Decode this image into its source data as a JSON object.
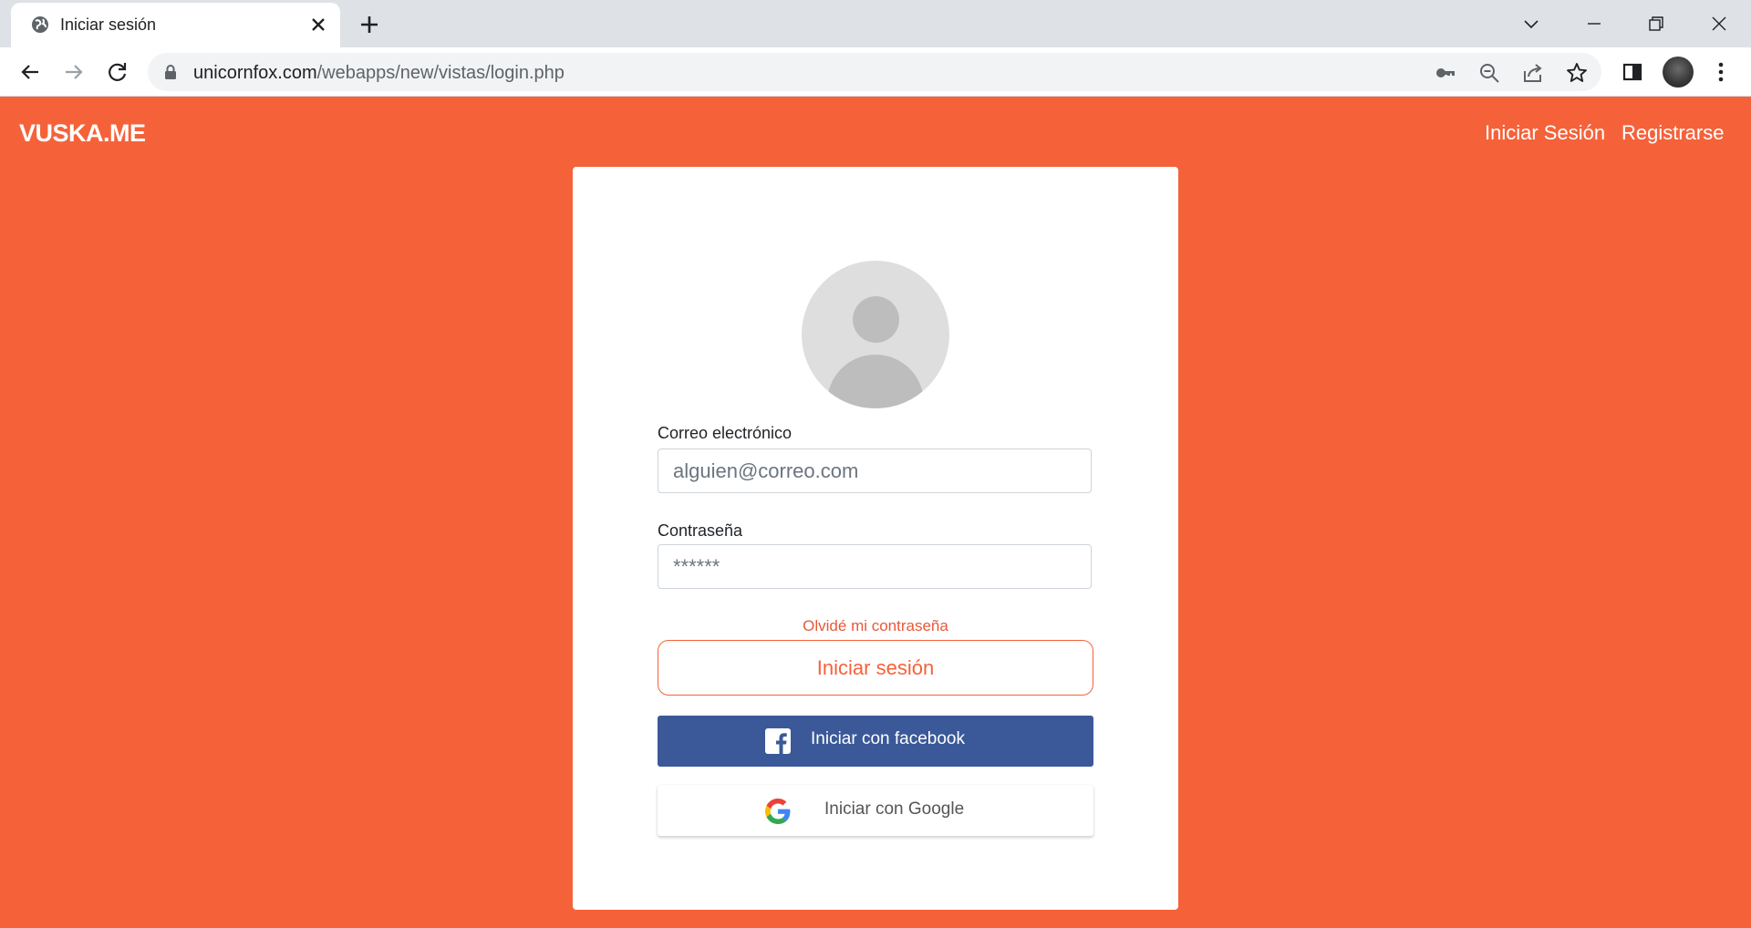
{
  "browser": {
    "tab_title": "Iniciar sesión",
    "url_host": "unicornfox.com",
    "url_path": "/webapps/new/vistas/login.php"
  },
  "navbar": {
    "brand": "VUSKA.ME",
    "links": [
      "Iniciar Sesión",
      "Registrarse"
    ]
  },
  "login": {
    "email_label": "Correo electrónico",
    "email_placeholder": "alguien@correo.com",
    "password_label": "Contraseña",
    "password_placeholder": "******",
    "forgot_link": "Olvidé mi contraseña",
    "submit_label": "Iniciar sesión",
    "facebook_label": "Iniciar con facebook",
    "google_label": "Iniciar con Google"
  },
  "colors": {
    "background": "#f5623a",
    "facebook": "#3b5998",
    "accent": "#f5623a"
  },
  "icons": [
    "globe-icon",
    "close-icon",
    "plus-icon",
    "chevron-down-icon",
    "minimize-icon",
    "restore-icon",
    "window-close-icon",
    "back-icon",
    "forward-icon",
    "reload-icon",
    "lock-icon",
    "key-icon",
    "zoom-out-icon",
    "share-icon",
    "star-icon",
    "side-panel-icon",
    "profile-avatar",
    "kebab-menu-icon",
    "user-placeholder-icon",
    "facebook-icon",
    "google-icon"
  ]
}
